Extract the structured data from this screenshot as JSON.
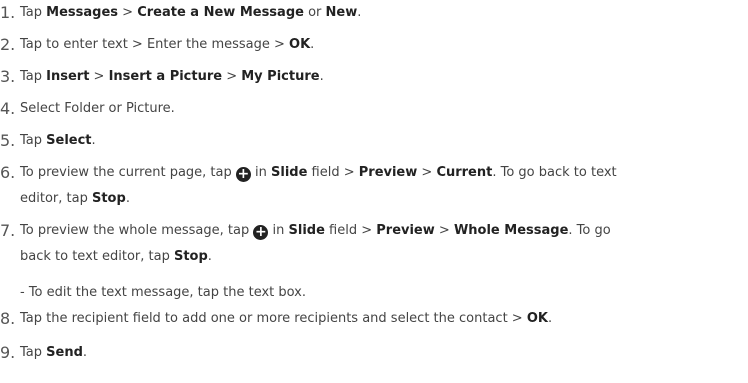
{
  "steps": [
    {
      "num": "1.",
      "t1": "Tap ",
      "b1": "Messages",
      "t2": " > ",
      "b2": "Create a New Message",
      "t3": " or ",
      "b3": "New",
      "t4": "."
    },
    {
      "num": "2.",
      "t1": "Tap to enter text > Enter the message > ",
      "b1": "OK",
      "t2": "."
    },
    {
      "num": "3.",
      "t1": "Tap ",
      "b1": "Insert",
      "t2": " > ",
      "b2": "Insert a Picture",
      "t3": " > ",
      "b3": "My Picture",
      "t4": "."
    },
    {
      "num": "4.",
      "t1": "Select Folder or Picture."
    },
    {
      "num": "5.",
      "t1": "Tap ",
      "b1": "Select",
      "t2": "."
    },
    {
      "num": "6.",
      "t1": "To preview the current page, tap ",
      "t2": " in ",
      "b1": "Slide",
      "t3": " field > ",
      "b2": "Preview",
      "t4": " > ",
      "b3": "Current",
      "t5": ". To go back to text",
      "t6": "editor, tap ",
      "b4": "Stop",
      "t7": "."
    },
    {
      "num": "7.",
      "t1": "To preview the whole message, tap ",
      "t2": " in ",
      "b1": "Slide",
      "t3": " field > ",
      "b2": "Preview",
      "t4": " > ",
      "b3": "Whole Message",
      "t5": ". To go",
      "t6": "back to text editor, tap ",
      "b4": "Stop",
      "t7": ".",
      "note": "- To edit the text message, tap the text box."
    },
    {
      "num": "8.",
      "t1": "Tap the recipient field to add one or more recipients and select the contact > ",
      "b1": "OK",
      "t2": "."
    },
    {
      "num": "9.",
      "t1": "Tap ",
      "b1": "Send",
      "t2": "."
    }
  ],
  "icons": {
    "plus_icon": "+"
  }
}
